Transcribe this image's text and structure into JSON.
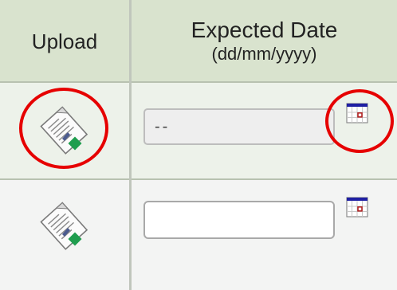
{
  "table": {
    "headers": {
      "upload": "Upload",
      "expected_date": "Expected Date",
      "date_format": "(dd/mm/yyyy)"
    },
    "rows": [
      {
        "upload_icon": "document-upload-icon",
        "date_value": "--",
        "date_placeholder": "",
        "date_editable": false,
        "calendar_icon": "calendar-icon"
      },
      {
        "upload_icon": "document-upload-icon",
        "date_value": "",
        "date_placeholder": "",
        "date_editable": true,
        "calendar_icon": "calendar-icon"
      }
    ]
  },
  "annotations": {
    "highlight_color": "#e60000"
  },
  "colors": {
    "header_bg": "#d9e3ce",
    "row1_bg": "#edf2ea",
    "row2_bg": "#f3f4f3",
    "calendar_accent": "#1f1fa3",
    "calendar_mark": "#b22222"
  }
}
